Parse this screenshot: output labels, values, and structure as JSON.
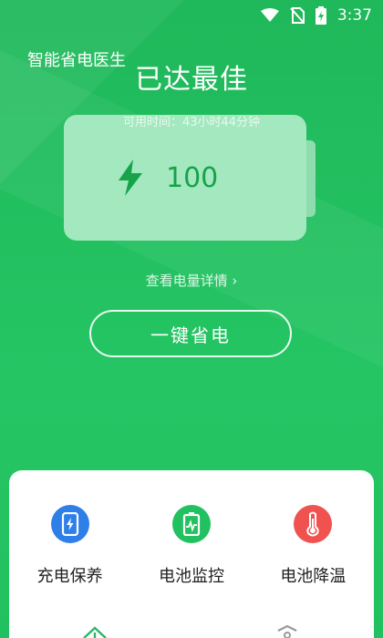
{
  "status_bar": {
    "time": "3:37"
  },
  "app": {
    "title": "智能省电医生"
  },
  "battery": {
    "headline": "已达最佳",
    "available_time": "可用时间：43小时44分钟",
    "level": "100",
    "detail_link": "查看电量详情 ›",
    "save_button": "一键省电"
  },
  "features": [
    {
      "label": "充电保养",
      "icon": "phone-charging-icon",
      "color": "#2f7fe8"
    },
    {
      "label": "电池监控",
      "icon": "battery-monitor-icon",
      "color": "#22c160"
    },
    {
      "label": "电池降温",
      "icon": "thermometer-icon",
      "color": "#f0524f"
    }
  ],
  "bottom_nav": {
    "icons": [
      "home-icon",
      "shield-icon"
    ]
  }
}
